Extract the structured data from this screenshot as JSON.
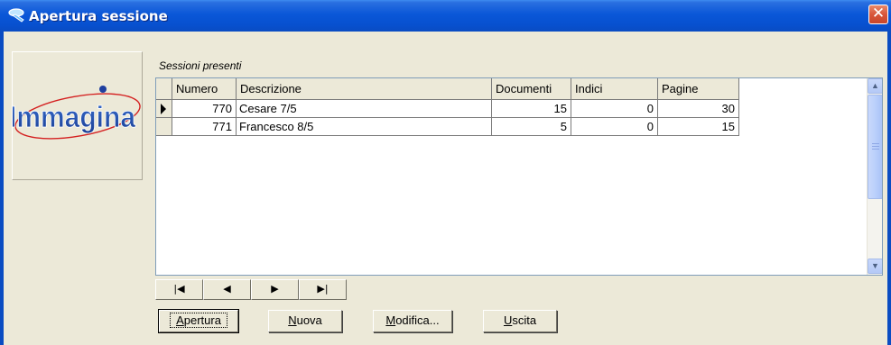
{
  "window": {
    "title": "Apertura sessione",
    "icon": "app-key-icon",
    "close_label": "✕"
  },
  "logo": {
    "text": "Immagina",
    "icon": "immagina-logo"
  },
  "grid": {
    "caption": "Sessioni presenti",
    "columns": [
      "Numero",
      "Descrizione",
      "Documenti",
      "Indici",
      "Pagine"
    ],
    "rows": [
      {
        "numero": "770",
        "descrizione": "Cesare 7/5",
        "documenti": "15",
        "indici": "0",
        "pagine": "30",
        "current": true
      },
      {
        "numero": "771",
        "descrizione": "Francesco 8/5",
        "documenti": "5",
        "indici": "0",
        "pagine": "15",
        "current": false
      }
    ]
  },
  "navigator": {
    "first": "|◀",
    "prior": "◀",
    "next": "▶",
    "last": "▶|"
  },
  "buttons": {
    "apertura": {
      "hot": "A",
      "rest": "pertura"
    },
    "nuova": {
      "hot": "N",
      "rest": "uova"
    },
    "modifica": {
      "hot": "M",
      "rest": "odifica..."
    },
    "uscita": {
      "hot": "U",
      "rest": "scita"
    }
  },
  "colors": {
    "titlebar": "#0a57d8",
    "close_button": "#d8553a",
    "face": "#ece9d8",
    "logo_text": "#1f4fa8",
    "logo_orbit": "#d42020"
  }
}
